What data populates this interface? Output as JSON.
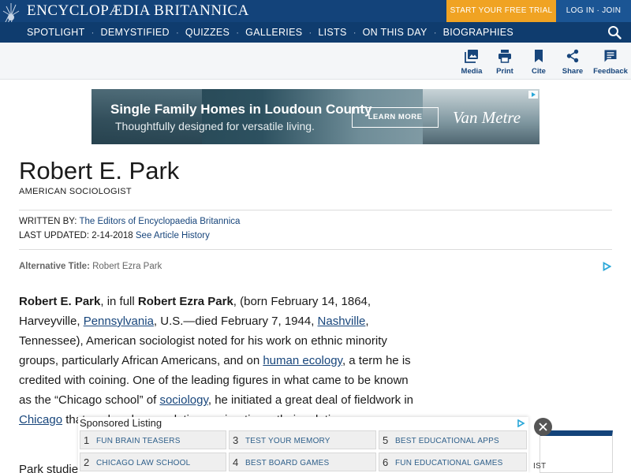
{
  "header": {
    "brand": "ENCYCLOPÆDIA BRITANNICA",
    "trial_label": "START YOUR FREE TRIAL",
    "login_label": "LOG IN · JOIN",
    "nav": [
      {
        "label": "SPOTLIGHT"
      },
      {
        "label": "DEMYSTIFIED"
      },
      {
        "label": "QUIZZES"
      },
      {
        "label": "GALLERIES"
      },
      {
        "label": "LISTS"
      },
      {
        "label": "ON THIS DAY"
      },
      {
        "label": "BIOGRAPHIES"
      }
    ],
    "nav_separator": "·"
  },
  "toolbar": {
    "media": "Media",
    "print": "Print",
    "cite": "Cite",
    "share": "Share",
    "feedback": "Feedback"
  },
  "ad": {
    "headline": "Single Family Homes in Loudoun County",
    "subline": "Thoughtfully designed  for versatile living.",
    "button": "LEARN MORE",
    "logo": "Van Metre"
  },
  "article": {
    "title": "Robert E. Park",
    "subtitle": "AMERICAN SOCIOLOGIST",
    "written_by_label": "WRITTEN BY:",
    "written_by": "The Editors of Encyclopaedia Britannica",
    "updated_label": "LAST UPDATED:",
    "updated_date": "2-14-2018",
    "history_link": "See Article History",
    "alt_title_label": "Alternative Title:",
    "alt_title": "Robert Ezra Park",
    "body": {
      "name_bold": "Robert E. Park",
      "t1": ", in full ",
      "fullname_bold": "Robert Ezra Park",
      "t2": ", (born February 14, 1864, Harveyville, ",
      "link_pennsylvania": "Pennsylvania",
      "t3": ", U.S.—died February 7, 1944, ",
      "link_nashville": "Nashville",
      "t4": ", Tennessee), American sociologist noted for his work on ethnic minority groups, particularly African Americans, and on ",
      "link_human_ecology": "human ecology",
      "t5": ", a term he is credited with coining. One of the leading figures in what came to be known as the “Chicago school” of ",
      "link_sociology": "sociology",
      "t6": ", he initiated a great deal of fieldwork in ",
      "link_chicago": "Chicago",
      "t7": " that explored race relations, migration, ethnic relations, so"
    },
    "para2_start": "Park studie"
  },
  "card": {
    "text": "IST"
  },
  "sponsored": {
    "title": "Sponsored Listing",
    "items": [
      {
        "num": "1",
        "label": "FUN BRAIN TEASERS"
      },
      {
        "num": "2",
        "label": "CHICAGO LAW SCHOOL"
      },
      {
        "num": "3",
        "label": "TEST YOUR MEMORY"
      },
      {
        "num": "4",
        "label": "BEST BOARD GAMES"
      },
      {
        "num": "5",
        "label": "BEST EDUCATIONAL APPS"
      },
      {
        "num": "6",
        "label": "FUN EDUCATIONAL GAMES"
      }
    ]
  },
  "colors": {
    "brand_blue": "#13437a",
    "nav_blue": "#0f3c6e",
    "trial_orange": "#f0a323",
    "link_blue": "#17457b"
  }
}
